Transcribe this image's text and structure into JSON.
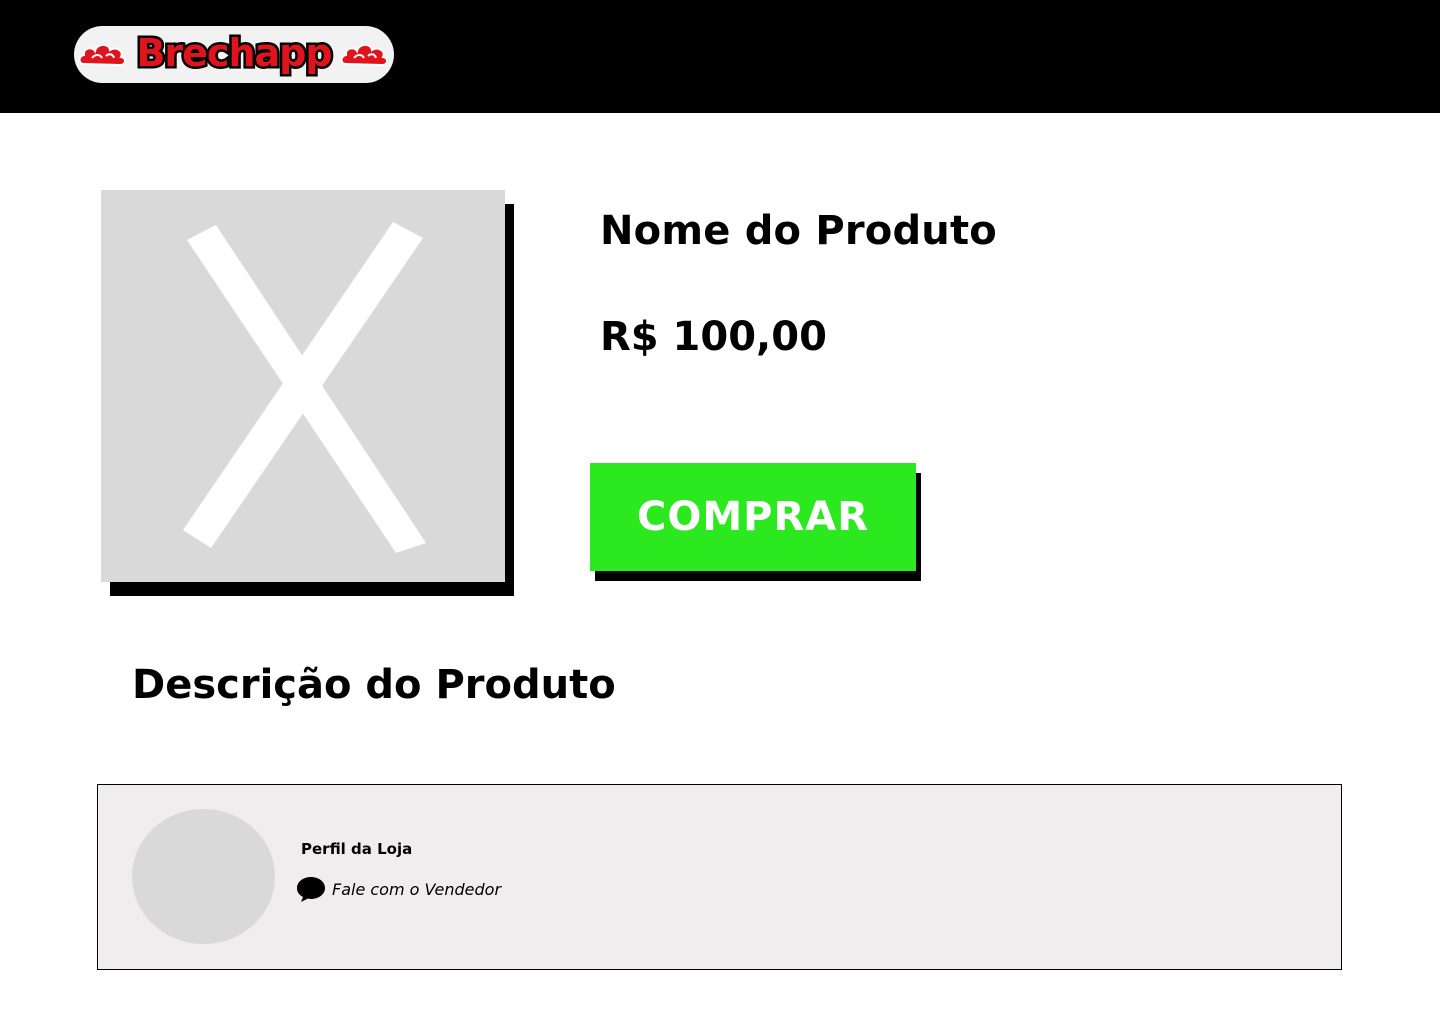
{
  "header": {
    "logo_text": "Brechapp",
    "logo_cloud_icon": "red-cloud-icon"
  },
  "product": {
    "name": "Nome do Produto",
    "price": "R$ 100,00",
    "image_icon": "image-placeholder-icon",
    "buy_label": "COMPRAR",
    "description_title": "Descrição do Produto"
  },
  "store": {
    "profile_label": "Perfil da Loja",
    "contact_label": "Fale com o Vendedor",
    "contact_icon": "chat-bubble-icon"
  },
  "colors": {
    "header_bg": "#000000",
    "buy_button": "#2ce81f",
    "logo_red": "#e0141c",
    "placeholder_gray": "#d9d9d9",
    "card_bg": "#efeded"
  }
}
